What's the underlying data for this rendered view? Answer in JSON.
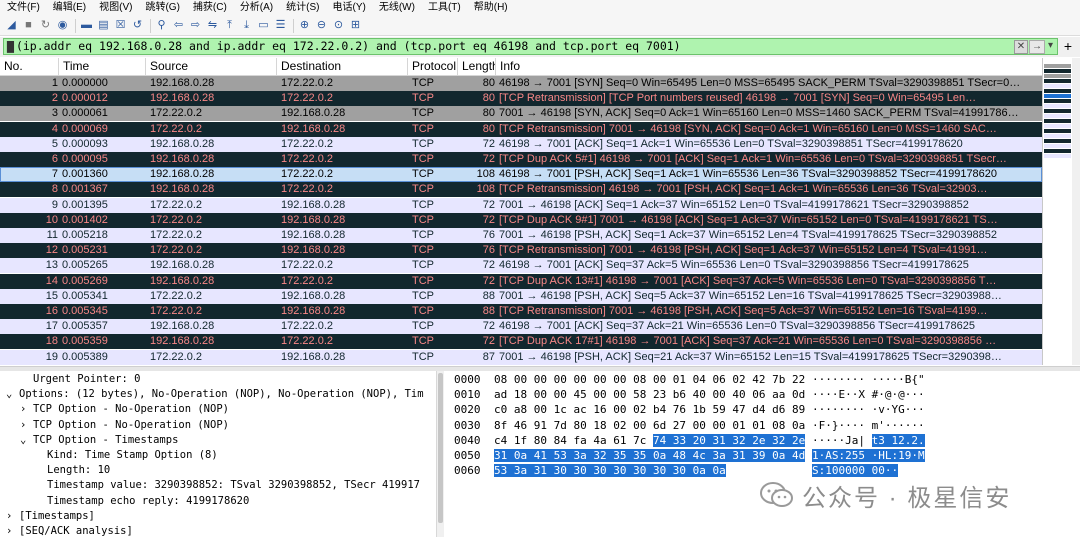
{
  "menu": [
    "文件(F)",
    "编辑(E)",
    "视图(V)",
    "跳转(G)",
    "捕获(C)",
    "分析(A)",
    "统计(S)",
    "电话(Y)",
    "无线(W)",
    "工具(T)",
    "帮助(H)"
  ],
  "toolbar_icons": [
    "shark-fin-start-icon",
    "stop-icon",
    "restart-icon",
    "options-gear-icon",
    "open-folder-icon",
    "save-file-icon",
    "close-file-icon",
    "reload-icon",
    "find-icon",
    "go-back-icon",
    "go-forward-icon",
    "go-to-packet-icon",
    "go-first-icon",
    "go-last-icon",
    "autoscroll-icon",
    "colorize-icon",
    "zoom-in-icon",
    "zoom-out-icon",
    "zoom-normal-icon",
    "resize-columns-icon"
  ],
  "filter": {
    "text": "(ip.addr eq 192.168.0.28 and ip.addr eq 172.22.0.2) and (tcp.port eq 46198 and tcp.port eq 7001)",
    "bg_color": "#aff3af"
  },
  "columns": [
    "No.",
    "Time",
    "Source",
    "Destination",
    "Protocol",
    "Length",
    "Info"
  ],
  "packets": [
    {
      "no": "1",
      "time": "0.000000",
      "src": "192.168.0.28",
      "dst": "172.22.0.2",
      "proto": "TCP",
      "len": "80",
      "info": "46198 → 7001 [SYN] Seq=0 Win=65495 Len=0 MSS=65495 SACK_PERM TSval=3290398851 TSecr=0…",
      "style": "gray"
    },
    {
      "no": "2",
      "time": "0.000012",
      "src": "192.168.0.28",
      "dst": "172.22.0.2",
      "proto": "TCP",
      "len": "80",
      "info": "[TCP Retransmission] [TCP Port numbers reused] 46198 → 7001 [SYN] Seq=0 Win=65495 Len…",
      "style": "dark"
    },
    {
      "no": "3",
      "time": "0.000061",
      "src": "172.22.0.2",
      "dst": "192.168.0.28",
      "proto": "TCP",
      "len": "80",
      "info": "7001 → 46198 [SYN, ACK] Seq=0 Ack=1 Win=65160 Len=0 MSS=1460 SACK_PERM TSval=41991786…",
      "style": "gray"
    },
    {
      "no": "4",
      "time": "0.000069",
      "src": "172.22.0.2",
      "dst": "192.168.0.28",
      "proto": "TCP",
      "len": "80",
      "info": "[TCP Retransmission] 7001 → 46198 [SYN, ACK] Seq=0 Ack=1 Win=65160 Len=0 MSS=1460 SAC…",
      "style": "dark"
    },
    {
      "no": "5",
      "time": "0.000093",
      "src": "192.168.0.28",
      "dst": "172.22.0.2",
      "proto": "TCP",
      "len": "72",
      "info": "46198 → 7001 [ACK] Seq=1 Ack=1 Win=65536 Len=0 TSval=3290398851 TSecr=4199178620",
      "style": "light"
    },
    {
      "no": "6",
      "time": "0.000095",
      "src": "192.168.0.28",
      "dst": "172.22.0.2",
      "proto": "TCP",
      "len": "72",
      "info": "[TCP Dup ACK 5#1] 46198 → 7001 [ACK] Seq=1 Ack=1 Win=65536 Len=0 TSval=3290398851 TSecr…",
      "style": "dark"
    },
    {
      "no": "7",
      "time": "0.001360",
      "src": "192.168.0.28",
      "dst": "172.22.0.2",
      "proto": "TCP",
      "len": "108",
      "info": "46198 → 7001 [PSH, ACK] Seq=1 Ack=1 Win=65536 Len=36 TSval=3290398852 TSecr=4199178620",
      "style": "selected"
    },
    {
      "no": "8",
      "time": "0.001367",
      "src": "192.168.0.28",
      "dst": "172.22.0.2",
      "proto": "TCP",
      "len": "108",
      "info": "[TCP Retransmission] 46198 → 7001 [PSH, ACK] Seq=1 Ack=1 Win=65536 Len=36 TSval=32903…",
      "style": "dark"
    },
    {
      "no": "9",
      "time": "0.001395",
      "src": "172.22.0.2",
      "dst": "192.168.0.28",
      "proto": "TCP",
      "len": "72",
      "info": "7001 → 46198 [ACK] Seq=1 Ack=37 Win=65152 Len=0 TSval=4199178621 TSecr=3290398852",
      "style": "light"
    },
    {
      "no": "10",
      "time": "0.001402",
      "src": "172.22.0.2",
      "dst": "192.168.0.28",
      "proto": "TCP",
      "len": "72",
      "info": "[TCP Dup ACK 9#1] 7001 → 46198 [ACK] Seq=1 Ack=37 Win=65152 Len=0 TSval=4199178621 TS…",
      "style": "dark"
    },
    {
      "no": "11",
      "time": "0.005218",
      "src": "172.22.0.2",
      "dst": "192.168.0.28",
      "proto": "TCP",
      "len": "76",
      "info": "7001 → 46198 [PSH, ACK] Seq=1 Ack=37 Win=65152 Len=4 TSval=4199178625 TSecr=3290398852",
      "style": "light"
    },
    {
      "no": "12",
      "time": "0.005231",
      "src": "172.22.0.2",
      "dst": "192.168.0.28",
      "proto": "TCP",
      "len": "76",
      "info": "[TCP Retransmission] 7001 → 46198 [PSH, ACK] Seq=1 Ack=37 Win=65152 Len=4 TSval=41991…",
      "style": "dark"
    },
    {
      "no": "13",
      "time": "0.005265",
      "src": "192.168.0.28",
      "dst": "172.22.0.2",
      "proto": "TCP",
      "len": "72",
      "info": "46198 → 7001 [ACK] Seq=37 Ack=5 Win=65536 Len=0 TSval=3290398856 TSecr=4199178625",
      "style": "light"
    },
    {
      "no": "14",
      "time": "0.005269",
      "src": "192.168.0.28",
      "dst": "172.22.0.2",
      "proto": "TCP",
      "len": "72",
      "info": "[TCP Dup ACK 13#1] 46198 → 7001 [ACK] Seq=37 Ack=5 Win=65536 Len=0 TSval=3290398856 T…",
      "style": "dark"
    },
    {
      "no": "15",
      "time": "0.005341",
      "src": "172.22.0.2",
      "dst": "192.168.0.28",
      "proto": "TCP",
      "len": "88",
      "info": "7001 → 46198 [PSH, ACK] Seq=5 Ack=37 Win=65152 Len=16 TSval=4199178625 TSecr=32903988…",
      "style": "light"
    },
    {
      "no": "16",
      "time": "0.005345",
      "src": "172.22.0.2",
      "dst": "192.168.0.28",
      "proto": "TCP",
      "len": "88",
      "info": "[TCP Retransmission] 7001 → 46198 [PSH, ACK] Seq=5 Ack=37 Win=65152 Len=16 TSval=4199…",
      "style": "dark"
    },
    {
      "no": "17",
      "time": "0.005357",
      "src": "192.168.0.28",
      "dst": "172.22.0.2",
      "proto": "TCP",
      "len": "72",
      "info": "46198 → 7001 [ACK] Seq=37 Ack=21 Win=65536 Len=0 TSval=3290398856 TSecr=4199178625",
      "style": "light"
    },
    {
      "no": "18",
      "time": "0.005359",
      "src": "192.168.0.28",
      "dst": "172.22.0.2",
      "proto": "TCP",
      "len": "72",
      "info": "[TCP Dup ACK 17#1] 46198 → 7001 [ACK] Seq=37 Ack=21 Win=65536 Len=0 TSval=3290398856 …",
      "style": "dark"
    },
    {
      "no": "19",
      "time": "0.005389",
      "src": "172.22.0.2",
      "dst": "192.168.0.28",
      "proto": "TCP",
      "len": "87",
      "info": "7001 → 46198 [PSH, ACK] Seq=21 Ack=37 Win=65152 Len=15 TSval=4199178625 TSecr=3290398…",
      "style": "light"
    }
  ],
  "row_colors": {
    "gray": {
      "bg": "#a0a0a0",
      "fg": "#000000"
    },
    "dark": {
      "bg": "#12272e",
      "fg": "#f78787"
    },
    "light": {
      "bg": "#e7e6ff",
      "fg": "#12272e"
    },
    "selected": {
      "bg": "#c6def5",
      "fg": "#000000"
    }
  },
  "details": [
    {
      "indent": 2,
      "arrow": "",
      "text": "Urgent Pointer: 0"
    },
    {
      "indent": 1,
      "arrow": "v",
      "text": "Options: (12 bytes), No-Operation (NOP), No-Operation (NOP), Tim"
    },
    {
      "indent": 2,
      "arrow": ">",
      "text": "TCP Option - No-Operation (NOP)"
    },
    {
      "indent": 2,
      "arrow": ">",
      "text": "TCP Option - No-Operation (NOP)"
    },
    {
      "indent": 2,
      "arrow": "v",
      "text": "TCP Option - Timestamps"
    },
    {
      "indent": 3,
      "arrow": "",
      "text": "Kind: Time Stamp Option (8)"
    },
    {
      "indent": 3,
      "arrow": "",
      "text": "Length: 10"
    },
    {
      "indent": 3,
      "arrow": "",
      "text": "Timestamp value: 3290398852: TSval 3290398852, TSecr 419917"
    },
    {
      "indent": 3,
      "arrow": "",
      "text": "Timestamp echo reply: 4199178620"
    },
    {
      "indent": 1,
      "arrow": ">",
      "text": "[Timestamps]"
    },
    {
      "indent": 1,
      "arrow": ">",
      "text": "[SEQ/ACK analysis]"
    }
  ],
  "bytes": [
    {
      "off": "0000",
      "hex": "08 00 00 00 00 00 00 08  00 01 04 06 02 42 7b 22",
      "hl_from": -1,
      "ascii": "········ ·····B{\""
    },
    {
      "off": "0010",
      "hex": "ad 18 00 00 45 00 00 58  23 b6 40 00 40 06 aa 0d",
      "hl_from": -1,
      "ascii": "····E··X #·@·@···"
    },
    {
      "off": "0020",
      "hex": "c0 a8 00 1c ac 16 00 02  b4 76 1b 59 47 d4 d6 89",
      "hl_from": -1,
      "ascii": "········ ·v·YG···"
    },
    {
      "off": "0030",
      "hex": "8f 46 91 7d 80 18 02 00  6d 27 00 00 01 01 08 0a",
      "hl_from": -1,
      "ascii": "·F·}···· m'······"
    },
    {
      "off": "0040",
      "hex": "c4 1f 80 84 fa 4a 61 7c  74 33 20 31 32 2e 32 2e",
      "hl_from": 8,
      "ascii": "·····Ja| t3 12.2."
    },
    {
      "off": "0050",
      "hex": "31 0a 41 53 3a 32 35 35  0a 48 4c 3a 31 39 0a 4d",
      "hl_from": 0,
      "ascii": "1·AS:255 ·HL:19·M"
    },
    {
      "off": "0060",
      "hex": "53 3a 31 30 30 30 30 30  30 30 0a 0a",
      "hl_from": 0,
      "ascii": "S:100000 00··"
    }
  ],
  "watermark": "公众号 · 极星信安"
}
